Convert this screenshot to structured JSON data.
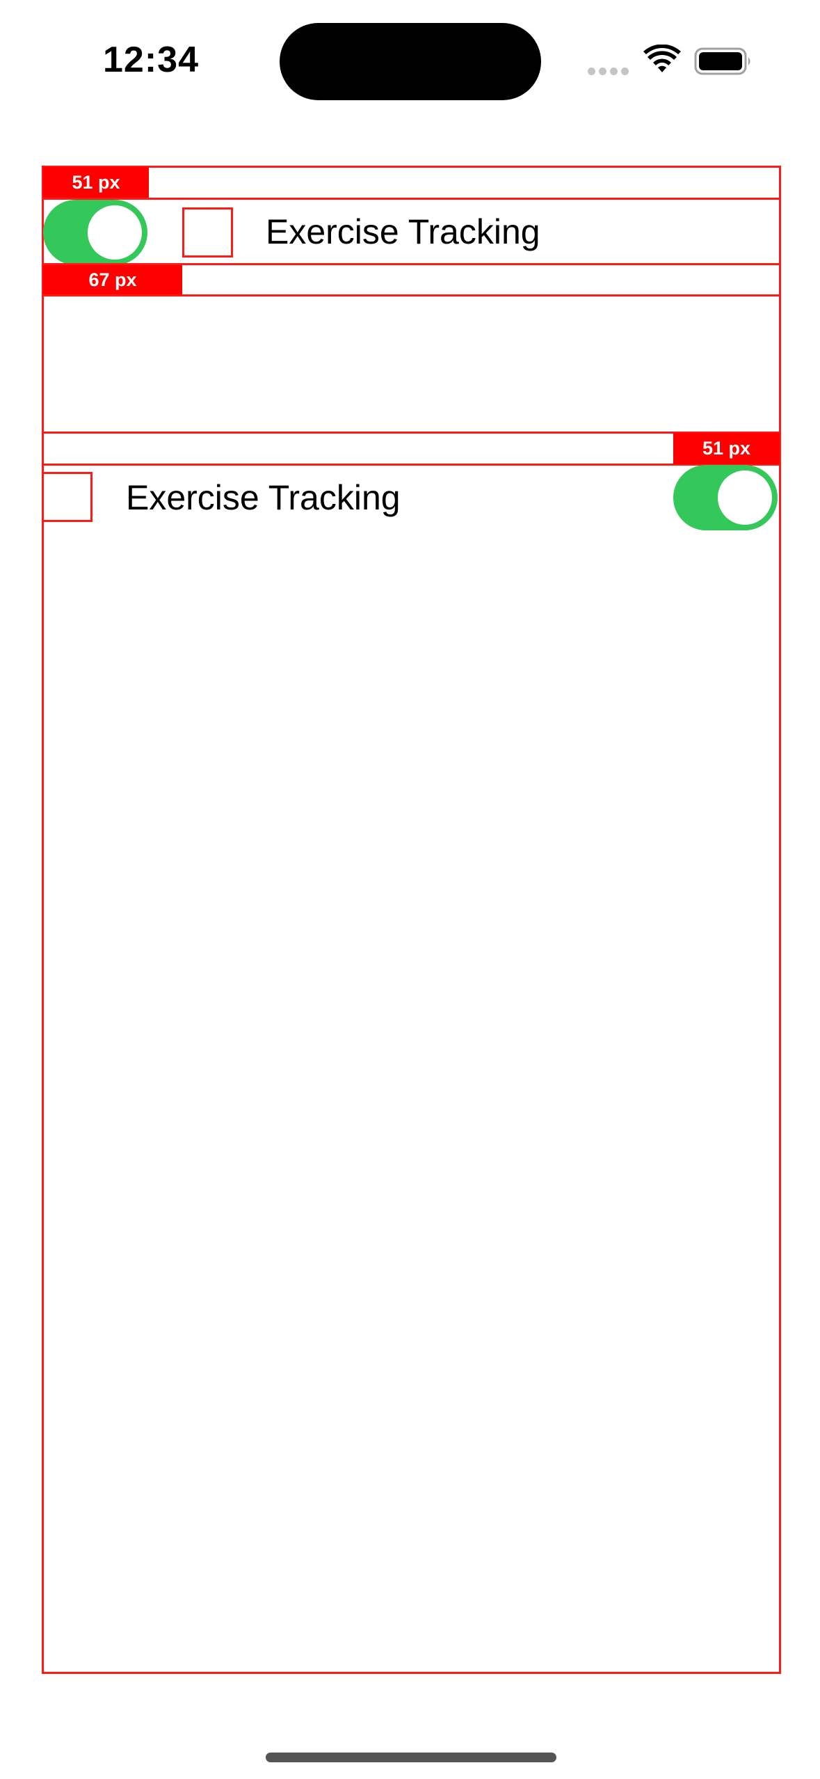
{
  "status_bar": {
    "time": "12:34",
    "signal_icon": "signal-dots-icon",
    "wifi_icon": "wifi-icon",
    "battery_icon": "battery-icon"
  },
  "colors": {
    "outline": "#ff1a1a",
    "tag_background": "#ff0000",
    "toggle_on": "#34c759"
  },
  "layout_preview_1": {
    "spacer_top_tag": "51 px",
    "row": {
      "toggle_on": true,
      "label": "Exercise Tracking"
    },
    "spacer_bottom_tag": "67 px"
  },
  "layout_preview_2": {
    "spacer_top_tag": "51 px",
    "row": {
      "label": "Exercise Tracking",
      "toggle_on": true
    }
  }
}
